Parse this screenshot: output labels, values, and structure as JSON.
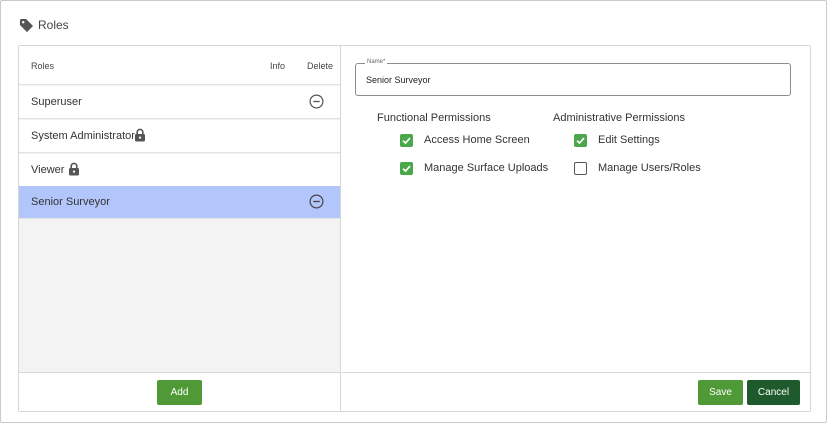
{
  "page": {
    "title": "Roles",
    "icon": "tag-icon"
  },
  "roles_list": {
    "headers": {
      "roles": "Roles",
      "info": "Info",
      "delete": "Delete"
    },
    "items": [
      {
        "label": "Superuser",
        "locked": false,
        "deletable": true,
        "selected": false
      },
      {
        "label": "System Administrator",
        "locked": true,
        "deletable": false,
        "selected": false
      },
      {
        "label": "Viewer",
        "locked": true,
        "deletable": false,
        "selected": false
      },
      {
        "label": "Senior Surveyor",
        "locked": false,
        "deletable": true,
        "selected": true
      }
    ],
    "add_label": "Add"
  },
  "editor": {
    "name_legend": "Name*",
    "name_value": "Senior Surveyor",
    "functional": {
      "heading": "Functional Permissions",
      "items": [
        {
          "label": "Access Home Screen",
          "checked": true
        },
        {
          "label": "Manage Surface Uploads",
          "checked": true
        }
      ]
    },
    "administrative": {
      "heading": "Administrative Permissions",
      "items": [
        {
          "label": "Edit Settings",
          "checked": true
        },
        {
          "label": "Manage Users/Roles",
          "checked": false
        }
      ]
    },
    "save_label": "Save",
    "cancel_label": "Cancel"
  },
  "colors": {
    "accent_green": "#4f9a36",
    "dark_green": "#1f5a2c",
    "selected_row": "#b3c6fb",
    "checkbox_green": "#4aa84a"
  }
}
